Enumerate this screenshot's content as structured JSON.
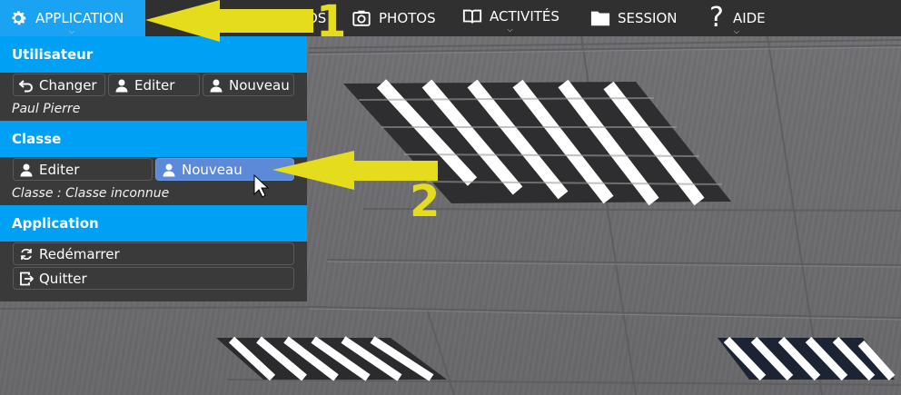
{
  "menubar": {
    "application": "APPLICATION",
    "photos_partial": "OS",
    "photos": "PHOTOS",
    "activites": "ACTIVITÉS",
    "session": "SESSION",
    "aide": "AIDE"
  },
  "panel": {
    "utilisateur": {
      "title": "Utilisateur",
      "btn_changer": "Changer",
      "btn_editer": "Editer",
      "btn_nouveau": "Nouveau",
      "user_name": "Paul Pierre"
    },
    "classe": {
      "title": "Classe",
      "btn_editer": "Editer",
      "btn_nouveau": "Nouveau",
      "info": "Classe : Classe inconnue"
    },
    "application": {
      "title": "Application",
      "btn_redemarrer": "Redémarrer",
      "btn_quitter": "Quitter"
    }
  },
  "annotations": {
    "step1": "1",
    "step2": "2"
  },
  "colors": {
    "accent": "#00a0f5",
    "active_button": "#5d8ad8",
    "annotation": "#e6dc1e",
    "menubar": "#303030"
  },
  "icons": [
    "gear-icon",
    "camera-icon",
    "book-icon",
    "folder-icon",
    "question-icon",
    "undo-icon",
    "user-icon",
    "restart-icon",
    "exit-icon"
  ]
}
